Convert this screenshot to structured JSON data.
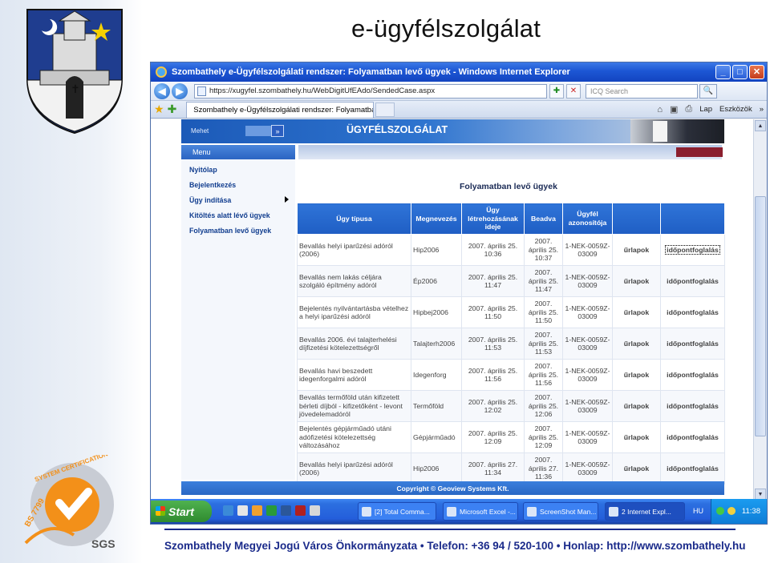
{
  "slide": {
    "title": "e-ügyfélszolgálat",
    "footer": "Szombathely Megyei Jogú Város Önkormányzata • Telefon: +36 94 / 520-100 • Honlap: http://www.szombathely.hu",
    "cert_ring_text": "SYSTEM CERTIFICATION",
    "cert_code": "BS 7799",
    "cert_brand": "SGS"
  },
  "window": {
    "title": "Szombathely e-Ügyfélszolgálati rendszer: Folyamatban levő ügyek - Windows Internet Explorer",
    "minimize": "_",
    "maximize": "□",
    "close": "✕"
  },
  "addressbar": {
    "back": "◀",
    "forward": "▶",
    "url": "https://xugyfel.szombathely.hu/WebDigitUfEAdo/SendedCase.aspx",
    "refresh": "✚",
    "stop": "✕",
    "search_placeholder": "ICQ Search",
    "search_btn": "🔍"
  },
  "tabs": {
    "active_tab": "Szombathely e-Ügyfélszolgálati rendszer: Folyamatba...",
    "home": "⌂",
    "feeds": "▣",
    "print": "⎙",
    "page_menu": "Lap",
    "tools_menu": "Eszközök",
    "more": "»"
  },
  "site": {
    "brand": "ÜGYFÉLSZOLGÁLAT",
    "search_label": "Mehet",
    "search_go": "»",
    "menu_label": "Menu",
    "sidebar": [
      "Nyitólap",
      "Bejelentkezés",
      "Ügy indítása",
      "Kitöltés alatt lévő ügyek",
      "Folyamatban levő ügyek"
    ],
    "content_title": "Folyamatban levő ügyek",
    "copyright": "Copyright © Geoview Systems Kft."
  },
  "table": {
    "headers": [
      "Ügy típusa",
      "Megnevezés",
      "Ügy létrehozásának ideje",
      "Beadva",
      "Ügyfél azonosítója",
      "",
      ""
    ],
    "rows": [
      {
        "type": "Bevallás helyi iparűzési adóról (2006)",
        "name": "Hip2006",
        "created": "2007. április 25. 10:36",
        "submitted": "2007. április 25. 10:37",
        "client_id": "1-NEK-0059Z-03009",
        "form": "űrlapok",
        "appointment": "időpontfoglalás"
      },
      {
        "type": "Bevallás nem lakás céljára szolgáló építmény adóról",
        "name": "Ép2006",
        "created": "2007. április 25. 11:47",
        "submitted": "2007. április 25. 11:47",
        "client_id": "1-NEK-0059Z-03009",
        "form": "űrlapok",
        "appointment": "időpontfoglalás"
      },
      {
        "type": "Bejelentés nyilvántartásba vételhez a helyi iparűzési adóról",
        "name": "Hipbej2006",
        "created": "2007. április 25. 11:50",
        "submitted": "2007. április 25. 11:50",
        "client_id": "1-NEK-0059Z-03009",
        "form": "űrlapok",
        "appointment": "időpontfoglalás"
      },
      {
        "type": "Bevallás 2006. évi talajterhelési díjfizetési kötelezettségről",
        "name": "Talajterh2006",
        "created": "2007. április 25. 11:53",
        "submitted": "2007. április 25. 11:53",
        "client_id": "1-NEK-0059Z-03009",
        "form": "űrlapok",
        "appointment": "időpontfoglalás"
      },
      {
        "type": "Bevallás havi beszedett idegenforgalmi adóról",
        "name": "Idegenforg",
        "created": "2007. április 25. 11:56",
        "submitted": "2007. április 25. 11:56",
        "client_id": "1-NEK-0059Z-03009",
        "form": "űrlapok",
        "appointment": "időpontfoglalás"
      },
      {
        "type": "Bevallás termőföld után kifizetett bérleti díjból - kifizetőként - levont jövedelemadóról",
        "name": "Termőföld",
        "created": "2007. április 25. 12:02",
        "submitted": "2007. április 25. 12:06",
        "client_id": "1-NEK-0059Z-03009",
        "form": "űrlapok",
        "appointment": "időpontfoglalás"
      },
      {
        "type": "Bejelentés gépjárműadó utáni adófizetési kötelezettség változásához",
        "name": "Gépjárműadó",
        "created": "2007. április 25. 12:09",
        "submitted": "2007. április 25. 12:09",
        "client_id": "1-NEK-0059Z-03009",
        "form": "űrlapok",
        "appointment": "időpontfoglalás"
      },
      {
        "type": "Bevallás helyi iparűzési adóról (2006)",
        "name": "Hip2006",
        "created": "2007. április 27. 11:34",
        "submitted": "2007. április 27. 11:36",
        "client_id": "1-NEK-0059Z-03009",
        "form": "űrlapok",
        "appointment": "időpontfoglalás"
      }
    ]
  },
  "taskbar": {
    "start": "Start",
    "tasks": [
      "[2] Total Comma...",
      "Microsoft Excel -...",
      "ScreenShot Man...",
      "2 Internet Expl..."
    ],
    "lang": "HU",
    "clock": "11:38"
  }
}
